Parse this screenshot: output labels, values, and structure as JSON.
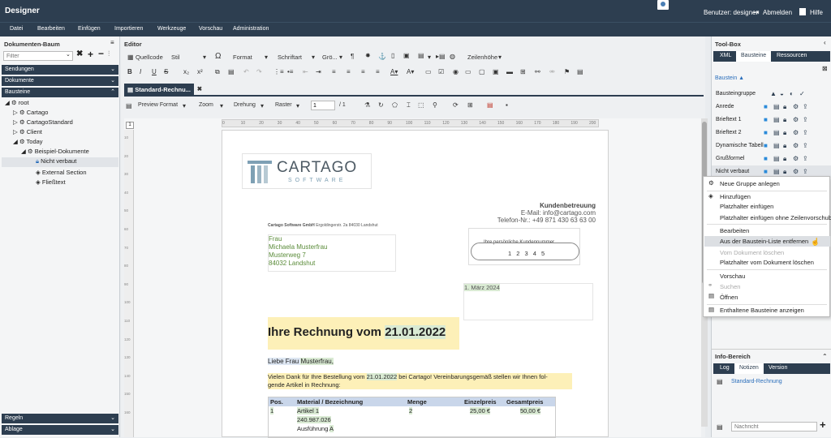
{
  "app": {
    "title": "Designer",
    "user": "Benutzer: designer",
    "logout": "Abmelden",
    "help": "Hilfe"
  },
  "menu": [
    "Datei",
    "Bearbeiten",
    "Einfügen",
    "Importieren",
    "Werkzeuge",
    "Vorschau",
    "Administration"
  ],
  "left": {
    "header": "Dokumenten-Baum",
    "filter_placeholder": "Filter",
    "sections": {
      "s1": "Sendungen",
      "s2": "Dokumente",
      "s3": "Bausteine",
      "b1": "Regeln",
      "b2": "Ablage"
    },
    "tree": {
      "root": "root",
      "cartago": "Cartago",
      "cartagostandard": "CartagoStandard",
      "client": "Client",
      "today": "Today",
      "beispiel": "Beispiel-Dokumente",
      "nichtverbaut": "Nicht verbaut",
      "external": "External Section",
      "fliess": "Fließtext"
    }
  },
  "editor": {
    "header": "Editor",
    "quellcode": "Quellcode",
    "stil": "Stil",
    "format": "Format",
    "schriftart": "Schriftart",
    "groesse": "Grö...",
    "zeilenhoehe": "Zeilenhöhe",
    "tab": "Standard-Rechnu...",
    "preview": "Preview Format",
    "zoom": "Zoom",
    "drehung": "Drehung",
    "raster": "Raster",
    "page_input": "1",
    "page_total": "/ 1",
    "ruler_start": "1"
  },
  "ruler": [
    "0",
    "10",
    "20",
    "30",
    "40",
    "50",
    "60",
    "70",
    "80",
    "90",
    "100",
    "110",
    "120",
    "130",
    "140",
    "150",
    "160",
    "170",
    "180",
    "190",
    "200"
  ],
  "vruler": [
    "10",
    "20",
    "30",
    "40",
    "50",
    "60",
    "70",
    "80",
    "90",
    "100",
    "110",
    "120",
    "130",
    "140",
    "150",
    "160"
  ],
  "doc": {
    "logo_main": "CARTAGO",
    "logo_sub": "SOFTWARE",
    "sender_bold": "Cartago Software GmbH",
    "sender_line": "Ergoldingerstr. 2a 84030 Landshut",
    "kb_title": "Kundenbetreuung",
    "kb_email": "E-Mail: info@cartago.com",
    "kb_tel": "Telefon-Nr.: +49 871 430 63 63 00",
    "kn_label": "Ihre persönliche Kundennummer",
    "kn_value": "1 2 3 4 5",
    "addr1": "Frau",
    "addr2": "Michaela Musterfrau",
    "addr3": "Musterweg 7",
    "addr4": "84032 Landshut",
    "date": "1. März 2024",
    "heading": "Ihre Rechnung vom",
    "heading_date": "21.01.2022",
    "greet1": "Liebe Frau",
    "greet2": "Musterfrau,",
    "body1": "Vielen Dank für Ihre Bestellung vom",
    "body_date": "21.01.2022",
    "body2": "bei Cartago! Vereinbarungsgemäß stellen wir Ihnen fol-",
    "body3": "gende Artikel in Rechnung:",
    "th": [
      "Pos.",
      "Material / Bezeichnung",
      "Menge",
      "Einzelpreis",
      "Gesamtpreis"
    ],
    "row": {
      "pos": "1",
      "art": "Artikel 1",
      "menge": "2",
      "ep": "25,00 €",
      "gp": "50,00 €"
    },
    "row2": "240.987.026",
    "row3a": "Ausführung",
    "row3b": "A"
  },
  "tool": {
    "header": "Tool-Box",
    "tabs": [
      "XML",
      "Bausteine",
      "Ressourcen"
    ],
    "col": "Baustein ▲",
    "items": [
      "Bausteingruppe",
      "Anrede",
      "Brieftext 1",
      "Brieftext 2",
      "Dynamische Tabell",
      "Grußformel",
      "Nicht verbaut"
    ],
    "info": "Info-Bereich",
    "infotabs": [
      "Log",
      "Notizen",
      "Version"
    ],
    "note": "Standard-Rechnung",
    "note_placeholder": "Nachricht"
  },
  "ctx": [
    "Neue Gruppe anlegen",
    "Hinzufügen",
    "Platzhalter einfügen",
    "Platzhalter einfügen ohne Zeilenvorschub",
    "Bearbeiten",
    "Aus der Baustein-Liste entfernen",
    "Vom Dokument löschen",
    "Platzhalter vom Dokument löschen",
    "Vorschau",
    "Suchen",
    "Öffnen",
    "Enthaltene Bausteine anzeigen"
  ]
}
